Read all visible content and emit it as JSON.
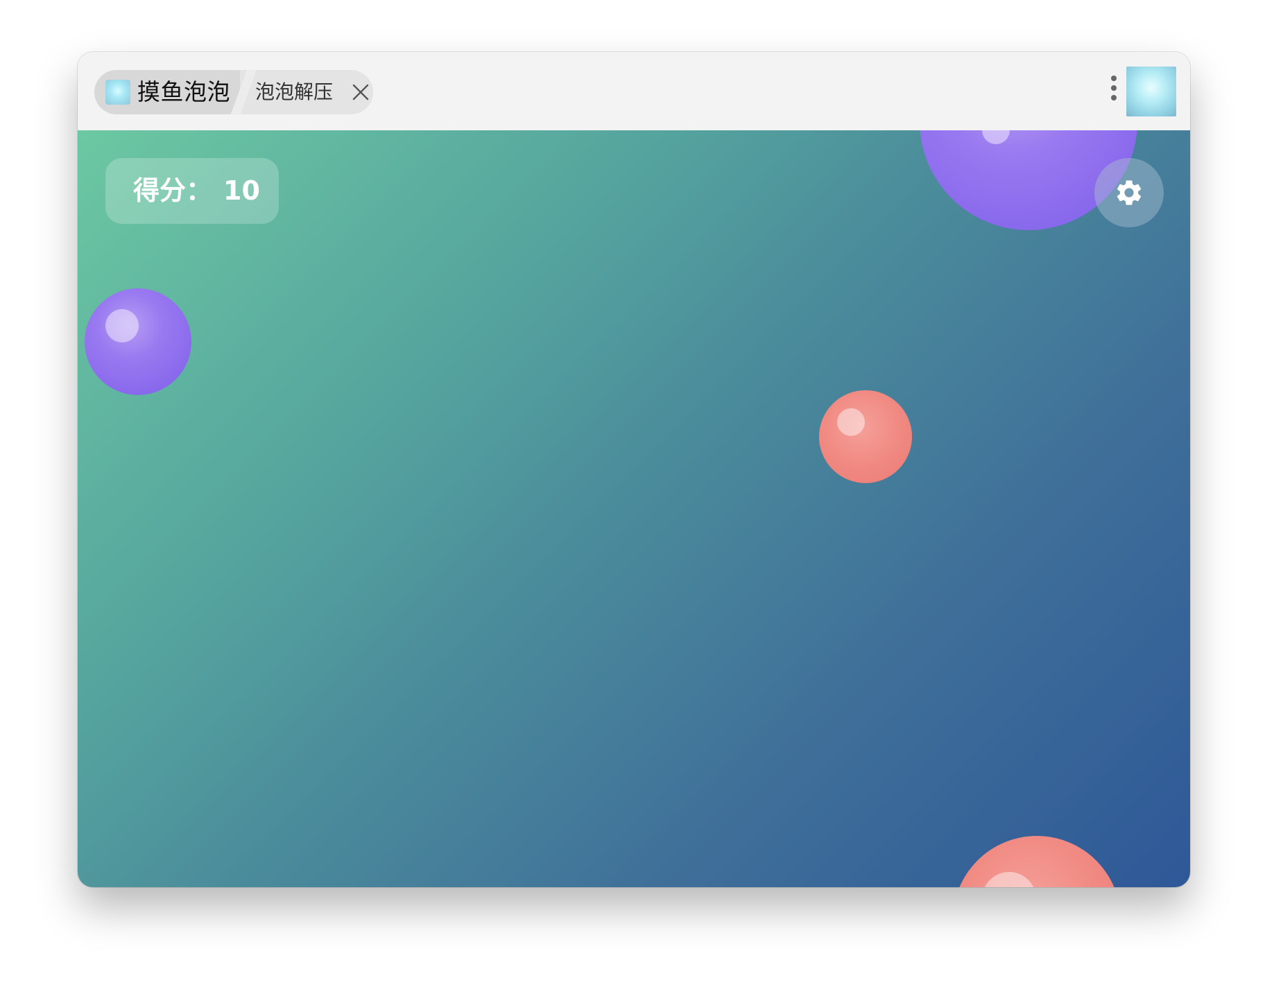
{
  "titlebar": {
    "app_name": "摸鱼泡泡",
    "tab_title": "泡泡解压",
    "icons": {
      "app": "bubble-app-icon",
      "close": "close-icon",
      "menu": "kebab-menu-icon",
      "profile": "bubble-thumbnail"
    }
  },
  "game": {
    "score_label": "得分：",
    "score_value": "10",
    "settings_icon": "gear-icon",
    "background_colors": [
      "#6cc8a2",
      "#2e5898"
    ],
    "bubble_colors": {
      "purple": "#8b6cee",
      "coral": "#f08a82"
    }
  }
}
